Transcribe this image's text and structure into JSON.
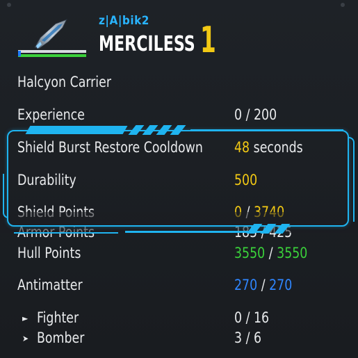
{
  "header": {
    "player_name": "z|A|bik2",
    "difficulty": "MERCILESS",
    "rank": "1",
    "ship_icon": "halcyon-carrier-icon"
  },
  "ship": {
    "name": "Halcyon Carrier"
  },
  "stats": {
    "experience": {
      "label": "Experience",
      "value": "0 / 200"
    },
    "shield_burst": {
      "label": "Shield Burst Restore Cooldown",
      "value": "48",
      "unit": "seconds"
    },
    "durability": {
      "label": "Durability",
      "value": "500"
    },
    "shield_points": {
      "label": "Shield Points",
      "current": "0",
      "sep": " / ",
      "max": "3740"
    },
    "armor_points": {
      "label": "Armor Points",
      "value": "185 / 425"
    },
    "hull_points": {
      "label": "Hull Points",
      "current": "3550",
      "sep": " / ",
      "max": "3550"
    },
    "antimatter": {
      "label": "Antimatter",
      "current": "270",
      "sep": " / ",
      "max": "270"
    },
    "fighter": {
      "label": "Fighter",
      "value": "0 / 16"
    },
    "bomber": {
      "label": "Bomber",
      "value": "3 / 6"
    }
  },
  "colors": {
    "accent_cyan": "#1fb4f0",
    "yellow": "#f2c914",
    "green": "#3ad13a",
    "blue": "#2f86ff",
    "name_blue": "#29b4ff"
  }
}
